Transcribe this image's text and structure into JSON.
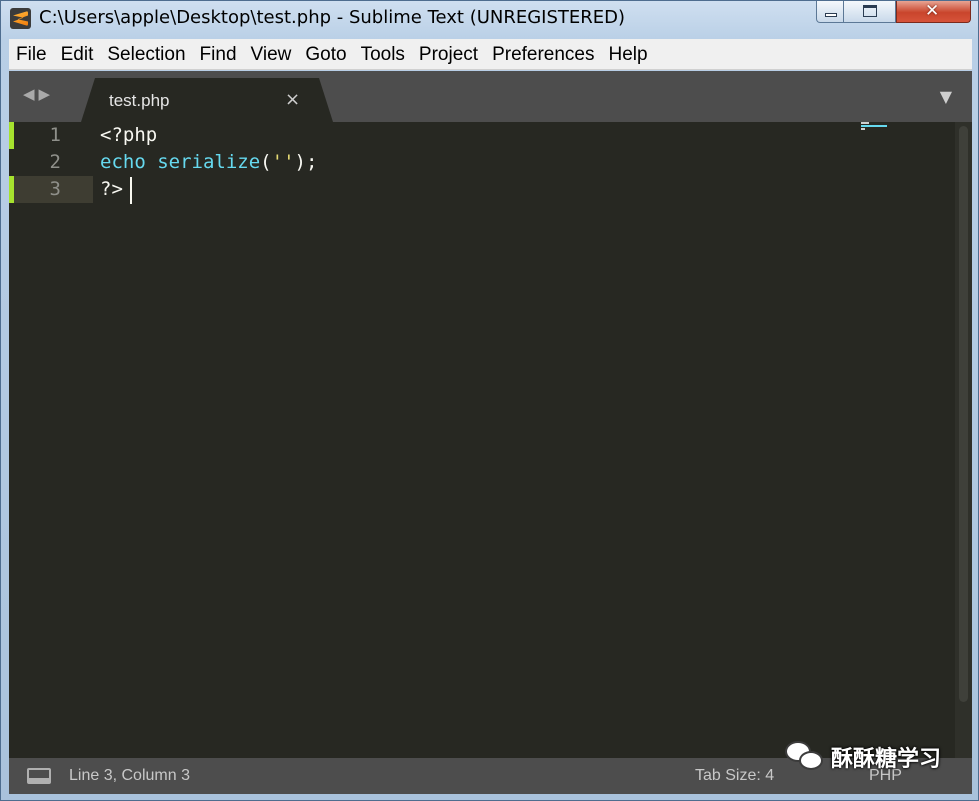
{
  "window": {
    "title": "C:\\Users\\apple\\Desktop\\test.php - Sublime Text (UNREGISTERED)",
    "minimize_icon": "minimize-icon",
    "maximize_icon": "maximize-icon",
    "close_glyph": "✕"
  },
  "menu": {
    "items": [
      "File",
      "Edit",
      "Selection",
      "Find",
      "View",
      "Goto",
      "Tools",
      "Project",
      "Preferences",
      "Help"
    ]
  },
  "tabs": {
    "nav_glyph": "◀▶",
    "active": {
      "label": "test.php",
      "close_glyph": "×"
    },
    "dropdown_glyph": "▼"
  },
  "editor": {
    "line_numbers": [
      "1",
      "2",
      "3"
    ],
    "lines": [
      [
        {
          "text": "<?php",
          "type": "plain"
        }
      ],
      [
        {
          "text": "echo",
          "type": "kw"
        },
        {
          "text": " ",
          "type": "plain"
        },
        {
          "text": "serialize",
          "type": "fn"
        },
        {
          "text": "(",
          "type": "plain"
        },
        {
          "text": "''",
          "type": "str"
        },
        {
          "text": ");",
          "type": "plain"
        }
      ],
      [
        {
          "text": "?>",
          "type": "plain"
        }
      ]
    ],
    "current_line": 3,
    "modified_lines": [
      1,
      3
    ],
    "colors": {
      "background": "#272822",
      "keyword": "#66d9ef",
      "string": "#e6db74",
      "foreground": "#f8f8f2",
      "gutter_marker": "#a6e22e"
    }
  },
  "status": {
    "position": "Line 3, Column 3",
    "tab_size": "Tab Size: 4",
    "syntax": "PHP",
    "panel_icon": "panel-icon"
  },
  "watermark": {
    "icon": "wechat-icon",
    "text": "酥酥糖学习"
  }
}
